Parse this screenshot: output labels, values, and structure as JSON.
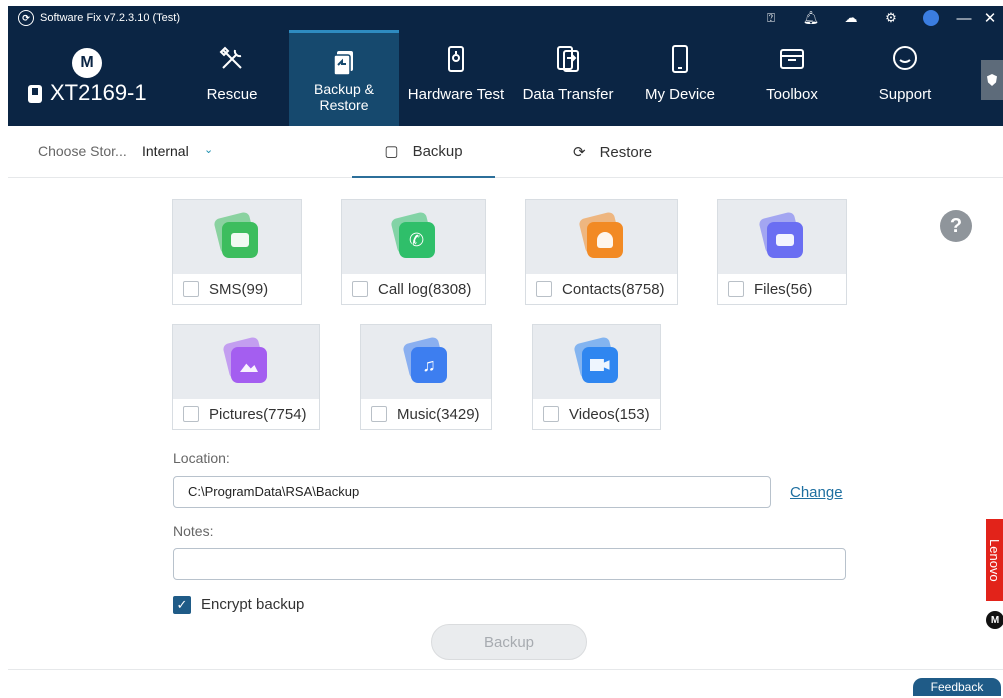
{
  "titlebar": {
    "title": "Software Fix v7.2.3.10 (Test)",
    "logo_icon": "motorola-logo-icon",
    "icons": [
      "help-icon",
      "bell-icon",
      "cloud-sync-icon",
      "settings-icon",
      "user-avatar-icon",
      "minimize-icon",
      "close-icon"
    ],
    "minimize": "—",
    "close": "✕"
  },
  "brand": {
    "logo_letter": "M",
    "device_name": "XT2169-1"
  },
  "nav": {
    "items": [
      {
        "label": "Rescue",
        "icon": "wrench-screwdriver-icon"
      },
      {
        "label": "Backup & Restore",
        "label_line1": "Backup &",
        "label_line2": "Restore",
        "icon": "backup-restore-icon",
        "active": true
      },
      {
        "label": "Hardware Test",
        "icon": "hardware-test-icon"
      },
      {
        "label": "Data Transfer",
        "icon": "data-transfer-icon"
      },
      {
        "label": "My Device",
        "icon": "phone-icon"
      },
      {
        "label": "Toolbox",
        "icon": "toolbox-icon"
      },
      {
        "label": "Support",
        "icon": "chat-bubble-icon"
      }
    ]
  },
  "storage": {
    "label": "Choose Stor...",
    "value": "Internal"
  },
  "tabs": {
    "backup": "Backup",
    "restore": "Restore",
    "active": "Backup"
  },
  "items": [
    {
      "label": "SMS(99)",
      "icon": "sms-icon",
      "color": "#3dbd5e"
    },
    {
      "label": "Call log(8308)",
      "icon": "call-log-icon",
      "color": "#2fbf6a"
    },
    {
      "label": "Contacts(8758)",
      "icon": "contacts-icon",
      "color": "#f28a24"
    },
    {
      "label": "Files(56)",
      "icon": "files-icon",
      "color": "#6a6ef2"
    },
    {
      "label": "Pictures(7754)",
      "icon": "pictures-icon",
      "color": "#a45ef0"
    },
    {
      "label": "Music(3429)",
      "icon": "music-icon",
      "color": "#3d7ef0"
    },
    {
      "label": "Videos(153)",
      "icon": "videos-icon",
      "color": "#2f86f0"
    }
  ],
  "location": {
    "label": "Location:",
    "value": "C:\\ProgramData\\RSA\\Backup",
    "change_link": "Change"
  },
  "notes": {
    "label": "Notes:",
    "value": ""
  },
  "encrypt": {
    "label": "Encrypt backup",
    "checked": true
  },
  "backup_button": "Backup",
  "side": {
    "lenovo": "Lenovo",
    "moto_letter": "M"
  },
  "feedback": "Feedback",
  "colors": {
    "header_bg": "#0b2544",
    "active_nav_bg": "#16496e",
    "accent": "#1f5b87",
    "lenovo_red": "#e2231a"
  }
}
